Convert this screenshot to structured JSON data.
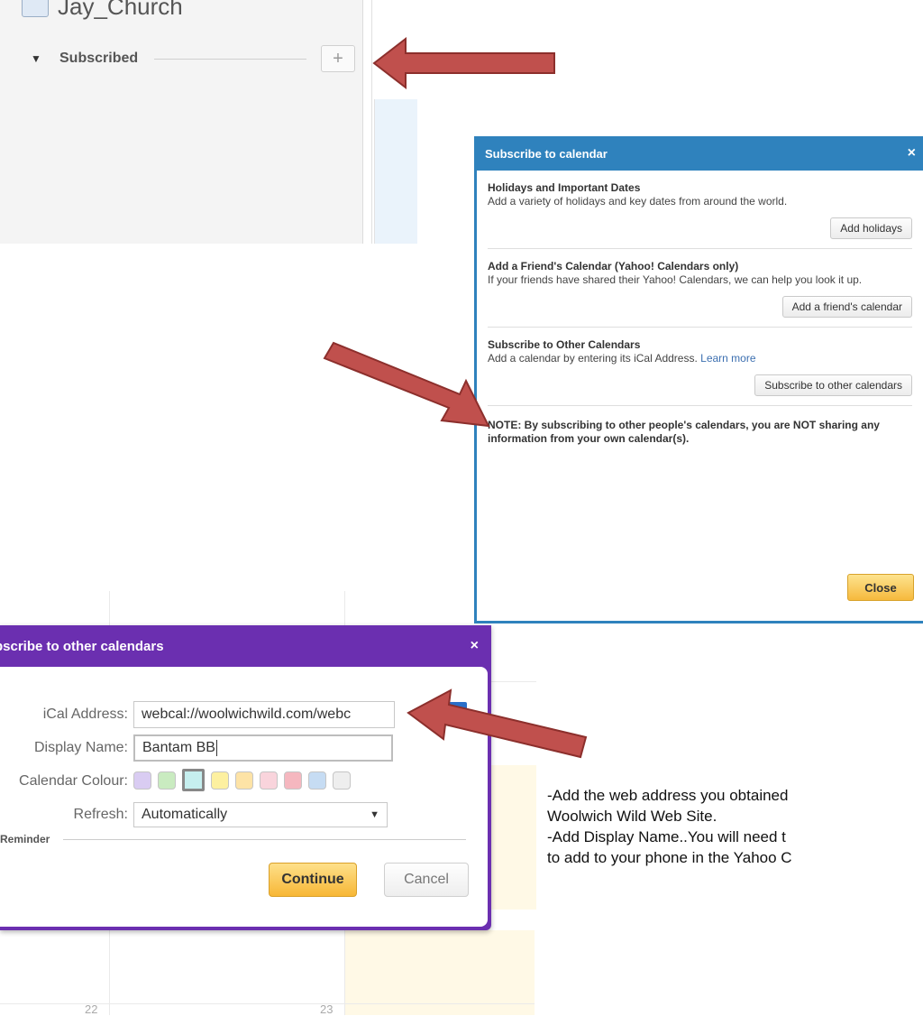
{
  "sidebar": {
    "calendar_name": "Jay_Church",
    "subscribed_label": "Subscribed",
    "plus_label": "+"
  },
  "subscribe_dialog": {
    "title": "Subscribe to calendar",
    "close_x": "×",
    "sections": [
      {
        "heading": "Holidays and Important Dates",
        "text": "Add a variety of holidays and key dates from around the world.",
        "button": "Add holidays"
      },
      {
        "heading": "Add a Friend's Calendar (Yahoo! Calendars only)",
        "text": "If your friends have shared their Yahoo! Calendars, we can help you look it up.",
        "button": "Add a friend's calendar"
      },
      {
        "heading": "Subscribe to Other Calendars",
        "text": "Add a calendar by entering its iCal Address.",
        "link": "Learn more",
        "button": "Subscribe to other calendars"
      }
    ],
    "note": "NOTE: By subscribing to other people's calendars, you are NOT sharing any information from your own calendar(s).",
    "close_button": "Close"
  },
  "other_dialog": {
    "title": "bscribe to other calendars",
    "close_x": "×",
    "ical_label": "iCal Address:",
    "ical_value": "webcal://woolwichwild.com/webc",
    "help_icon": "?",
    "display_name_label": "Display Name:",
    "display_name_value": "Bantam BB",
    "colour_label": "Calendar Colour:",
    "colours": [
      "#d9ccf2",
      "#c9ebc0",
      "#c6efef",
      "#fdf0a0",
      "#fde3a6",
      "#f9d4dc",
      "#f5b7bf",
      "#c6dcf3",
      "#eeeeee"
    ],
    "selected_colour_index": 2,
    "refresh_label": "Refresh:",
    "refresh_value": "Automatically",
    "reminder_label": "Reminder",
    "continue_button": "Continue",
    "cancel_button": "Cancel"
  },
  "background": {
    "day_numbers": [
      "22",
      "23"
    ]
  },
  "instructions": [
    "-Add the web address you obtained",
    "Woolwich Wild Web Site.",
    "-Add Display Name..You will need t",
    "to add to your phone in the Yahoo C"
  ],
  "arrow_color": "#c0504d"
}
